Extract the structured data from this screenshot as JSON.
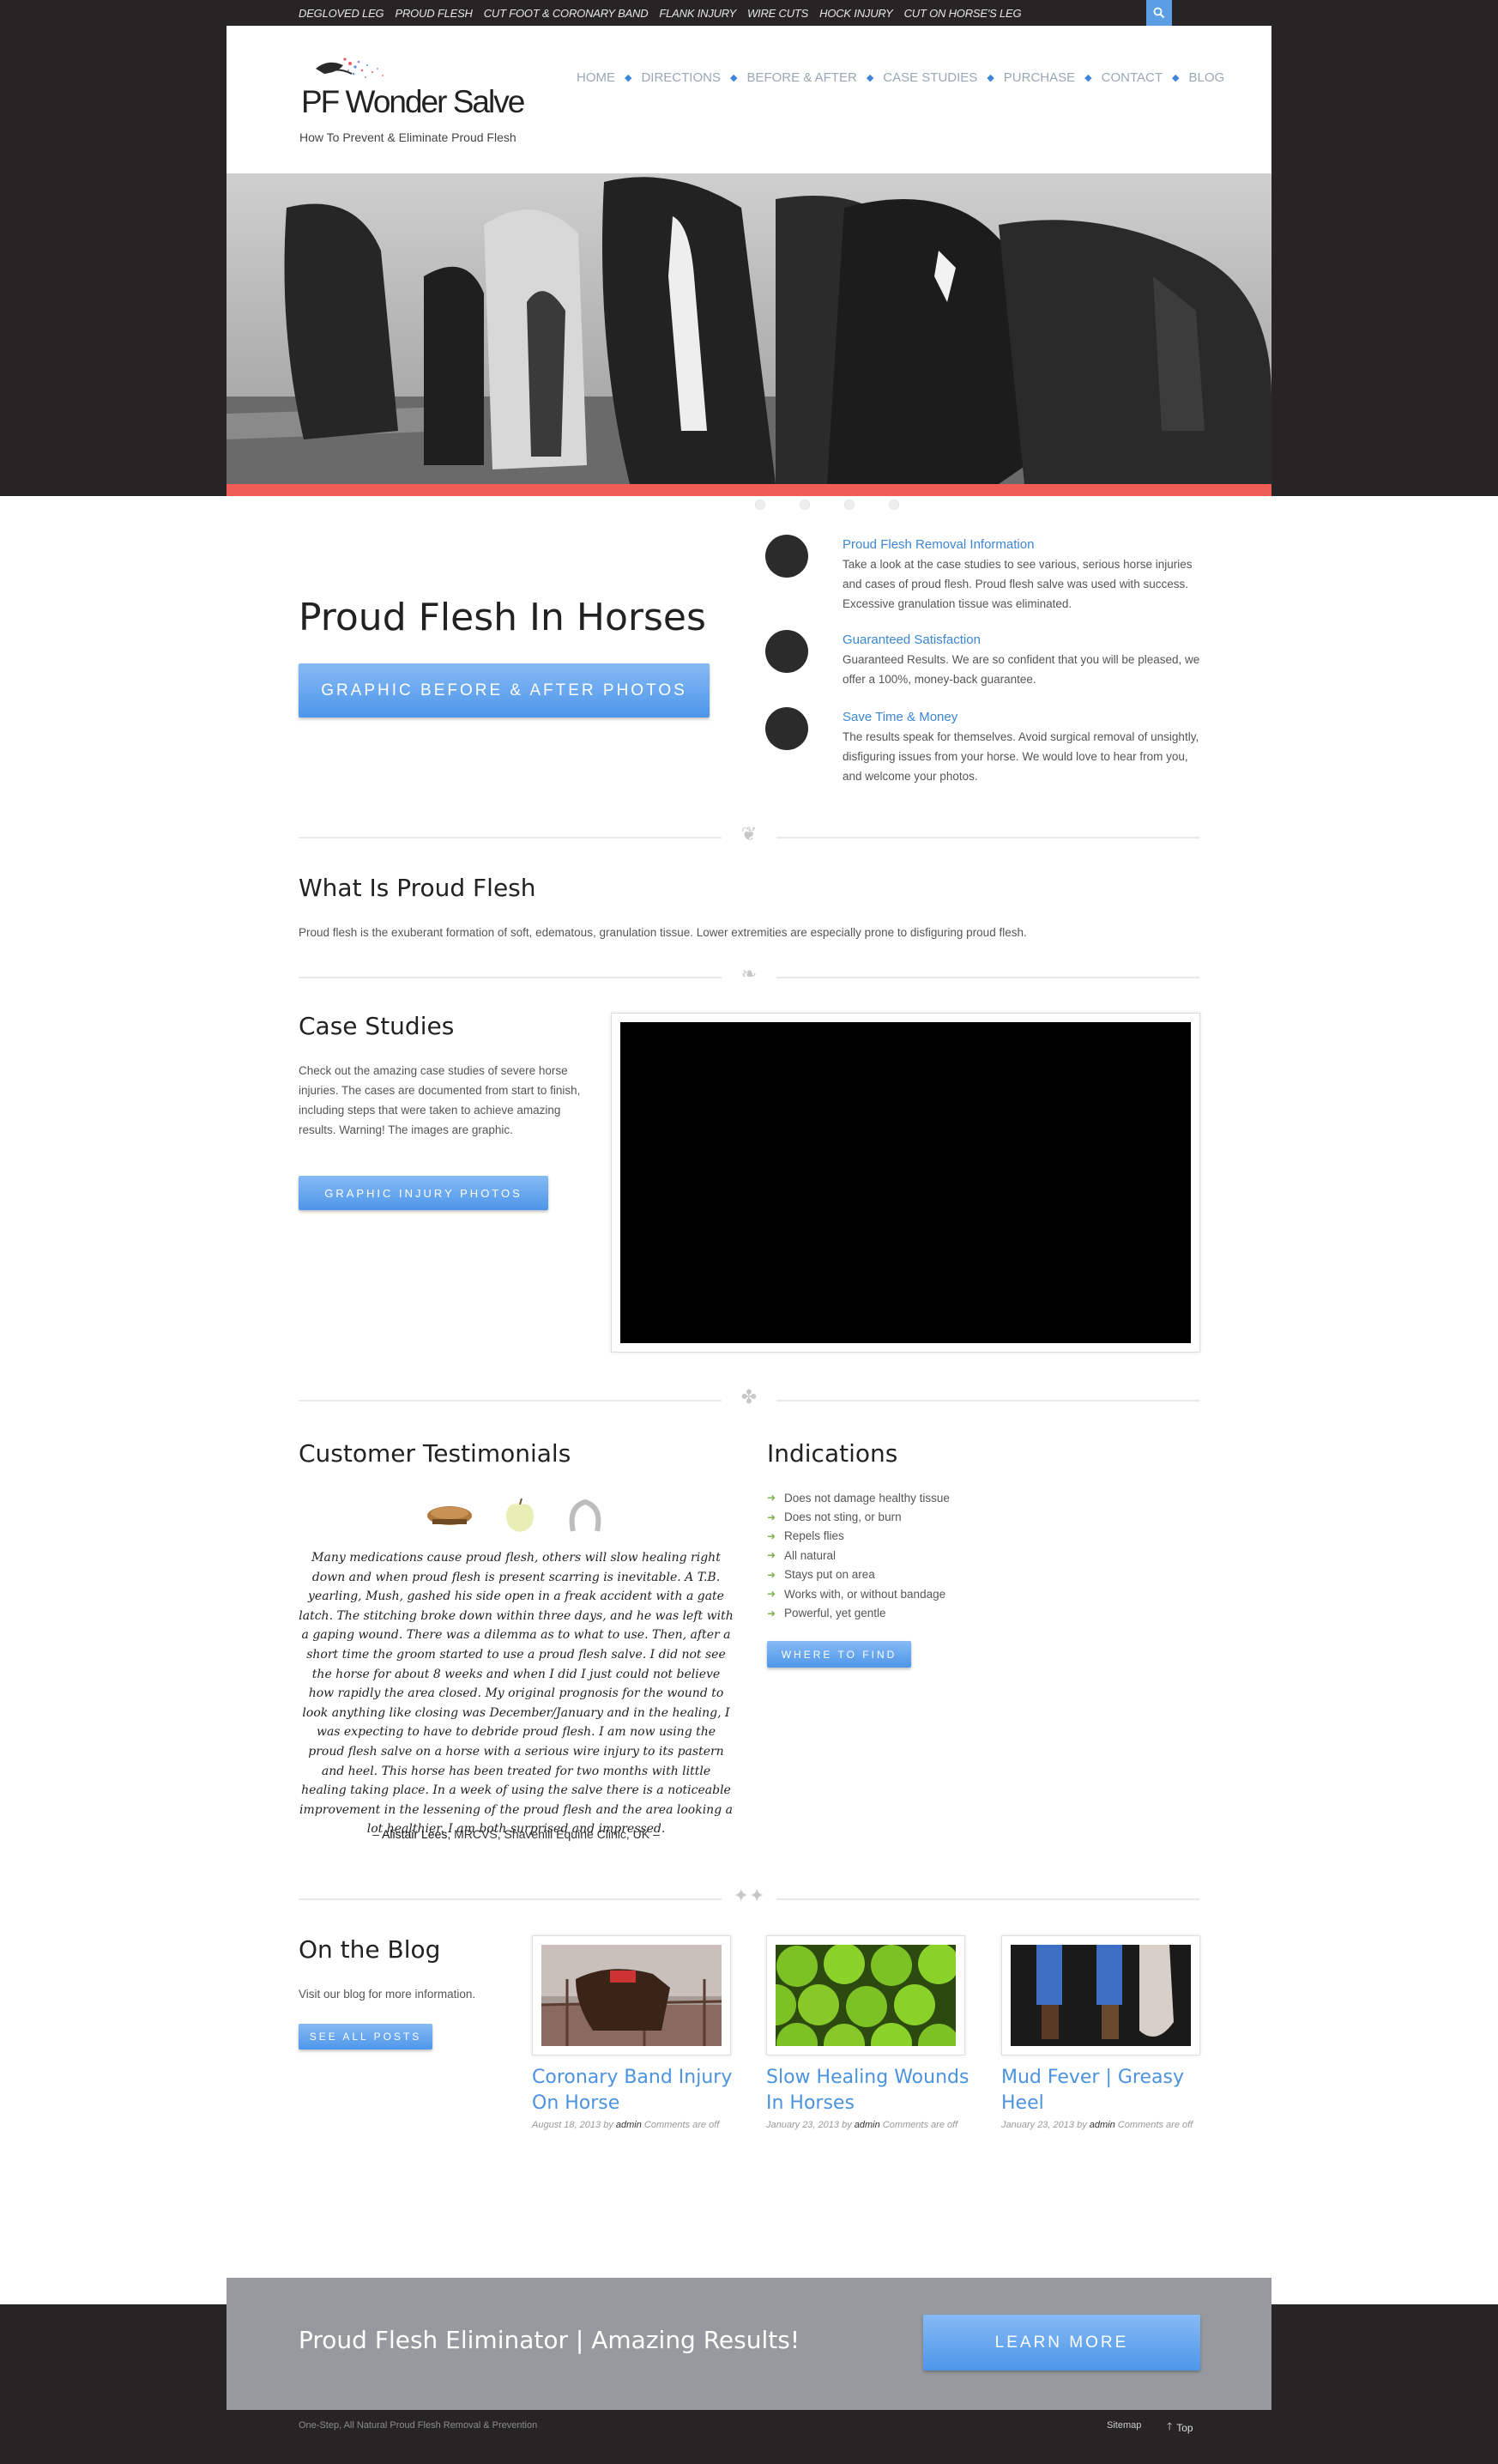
{
  "top_links": [
    "DEGLOVED LEG",
    "PROUD FLESH",
    "CUT FOOT & CORONARY BAND",
    "FLANK INJURY",
    "WIRE CUTS",
    "HOCK INJURY",
    "CUT ON HORSE'S LEG"
  ],
  "site": {
    "logo_text": "PF Wonder Salve",
    "tagline": "How To Prevent & Eliminate Proud Flesh"
  },
  "nav": [
    "HOME",
    "DIRECTIONS",
    "BEFORE & AFTER",
    "CASE STUDIES",
    "PURCHASE",
    "CONTACT",
    "BLOG"
  ],
  "intro": {
    "title": "Proud Flesh In Horses",
    "button": "GRAPHIC BEFORE & AFTER PHOTOS",
    "features": [
      {
        "title": "Proud Flesh Removal Information",
        "text": "Take a look at the case studies to see various, serious horse injuries and cases of proud flesh. Proud flesh salve was used with success. Excessive granulation tissue was eliminated."
      },
      {
        "title": "Guaranteed Satisfaction",
        "text": "Guaranteed Results. We are so confident that you will be pleased, we offer a 100%, money-back guarantee."
      },
      {
        "title": "Save Time & Money",
        "text": "The results speak for themselves. Avoid surgical removal of unsightly, disfiguring issues from your horse. We would love to hear from you, and welcome your photos."
      }
    ]
  },
  "what_is": {
    "title": "What Is Proud Flesh",
    "text": "Proud flesh is the exuberant formation of soft, edematous, granulation tissue. Lower extremities are especially prone to disfiguring proud flesh."
  },
  "case_studies": {
    "title": "Case Studies",
    "text": "Check out the amazing case studies of severe horse injuries. The cases are documented from start to finish, including steps that were taken to achieve amazing results. Warning! The images are graphic.",
    "button": "GRAPHIC INJURY PHOTOS"
  },
  "testimonials": {
    "title": "Customer Testimonials",
    "icons": [
      "brush-icon",
      "apple-icon",
      "horseshoe-icon"
    ],
    "quote": "Many medications cause proud flesh, others will slow healing right down and when proud flesh is present scarring is inevitable. A T.B. yearling, Mush, gashed his side open in a freak accident with a gate latch. The stitching broke down within three days, and he was left with a gaping wound. There was a dilemma as to what to use. Then, after a short time the groom started to use a proud flesh salve. I did not see the horse for about 8 weeks and when I did I just could not believe how rapidly the area closed. My original prognosis for the wound to look anything like closing was December/January and in the healing, I was expecting to have to debride proud flesh. I am now using the proud flesh salve on a horse with a serious wire injury to its pastern and heel. This horse has been treated for two months with little healing taking place. In a week of using the salve there is a noticeable improvement in the lessening of the proud flesh and the area looking a lot healthier. I am both surprised and impressed.",
    "author_dash_open": "– ",
    "author_name": "Alistair Lees",
    "author_info": ", MRCVS, Shavehill Equine Clinic, UK –"
  },
  "indications": {
    "title": "Indications",
    "items": [
      "Does not damage healthy tissue",
      "Does not sting, or burn",
      "Repels flies",
      "All natural",
      "Stays put on area",
      "Works with, or without bandage",
      "Powerful, yet gentle"
    ],
    "button": "WHERE TO FIND"
  },
  "blog": {
    "title": "On the Blog",
    "text": "Visit our blog for more information.",
    "button": "SEE ALL POSTS",
    "posts": [
      {
        "title": "Coronary Band Injury On Horse",
        "date": "August 18, 2013",
        "by": "by",
        "author": "admin",
        "comments": "Comments are off"
      },
      {
        "title": "Slow Healing Wounds In Horses",
        "date": "January 23, 2013",
        "by": "by",
        "author": "admin",
        "comments": "Comments are off"
      },
      {
        "title": "Mud Fever | Greasy Heel",
        "date": "January 23, 2013",
        "by": "by",
        "author": "admin",
        "comments": "Comments are off"
      }
    ]
  },
  "cta": {
    "text": "Proud Flesh Eliminator | Amazing Results!",
    "button": "LEARN MORE"
  },
  "footer": {
    "left": "One-Step, All Natural Proud Flesh Removal & Prevention",
    "sitemap": "Sitemap",
    "top": "Top"
  },
  "colors": {
    "accent_blue": "#4e96ea",
    "red_bar": "#ee5c55",
    "dark_bg": "#262425",
    "cta_gray": "#96999d"
  }
}
